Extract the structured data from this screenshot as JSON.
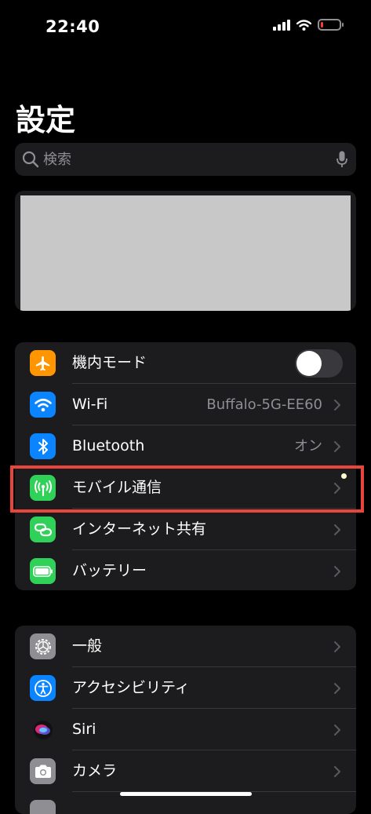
{
  "status_bar": {
    "time": "22:40",
    "battery_color": "#ff3b30",
    "battery_level": 0.1
  },
  "header": {
    "title": "設定"
  },
  "search": {
    "placeholder": "検索",
    "icon": "search-icon",
    "mic_icon": "mic-icon"
  },
  "profile_card": {
    "redacted": true
  },
  "groups": [
    {
      "items": [
        {
          "label": "機内モード",
          "icon": "airplane-icon",
          "icon_color": "#ff9500",
          "control": "toggle",
          "toggle_on": false
        },
        {
          "label": "Wi-Fi",
          "icon": "wifi-icon",
          "icon_color": "#0a84ff",
          "value": "Buffalo-5G-EE60"
        },
        {
          "label": "Bluetooth",
          "icon": "bluetooth-icon",
          "icon_color": "#0a84ff",
          "value": "オン"
        },
        {
          "label": "モバイル通信",
          "icon": "antenna-icon",
          "icon_color": "#30d158",
          "highlighted": true
        },
        {
          "label": "インターネット共有",
          "icon": "link-icon",
          "icon_color": "#30d158"
        },
        {
          "label": "バッテリー",
          "icon": "battery-icon",
          "icon_color": "#30d158"
        }
      ]
    },
    {
      "items": [
        {
          "label": "一般",
          "icon": "gear-icon",
          "icon_color": "#8e8e93"
        },
        {
          "label": "アクセシビリティ",
          "icon": "accessibility-icon",
          "icon_color": "#0a84ff"
        },
        {
          "label": "Siri",
          "icon": "siri-icon",
          "icon_color": "#1c1c1e"
        },
        {
          "label": "カメラ",
          "icon": "camera-icon",
          "icon_color": "#8e8e93"
        }
      ]
    }
  ],
  "annotation": {
    "highlight_color": "#e8453c"
  }
}
